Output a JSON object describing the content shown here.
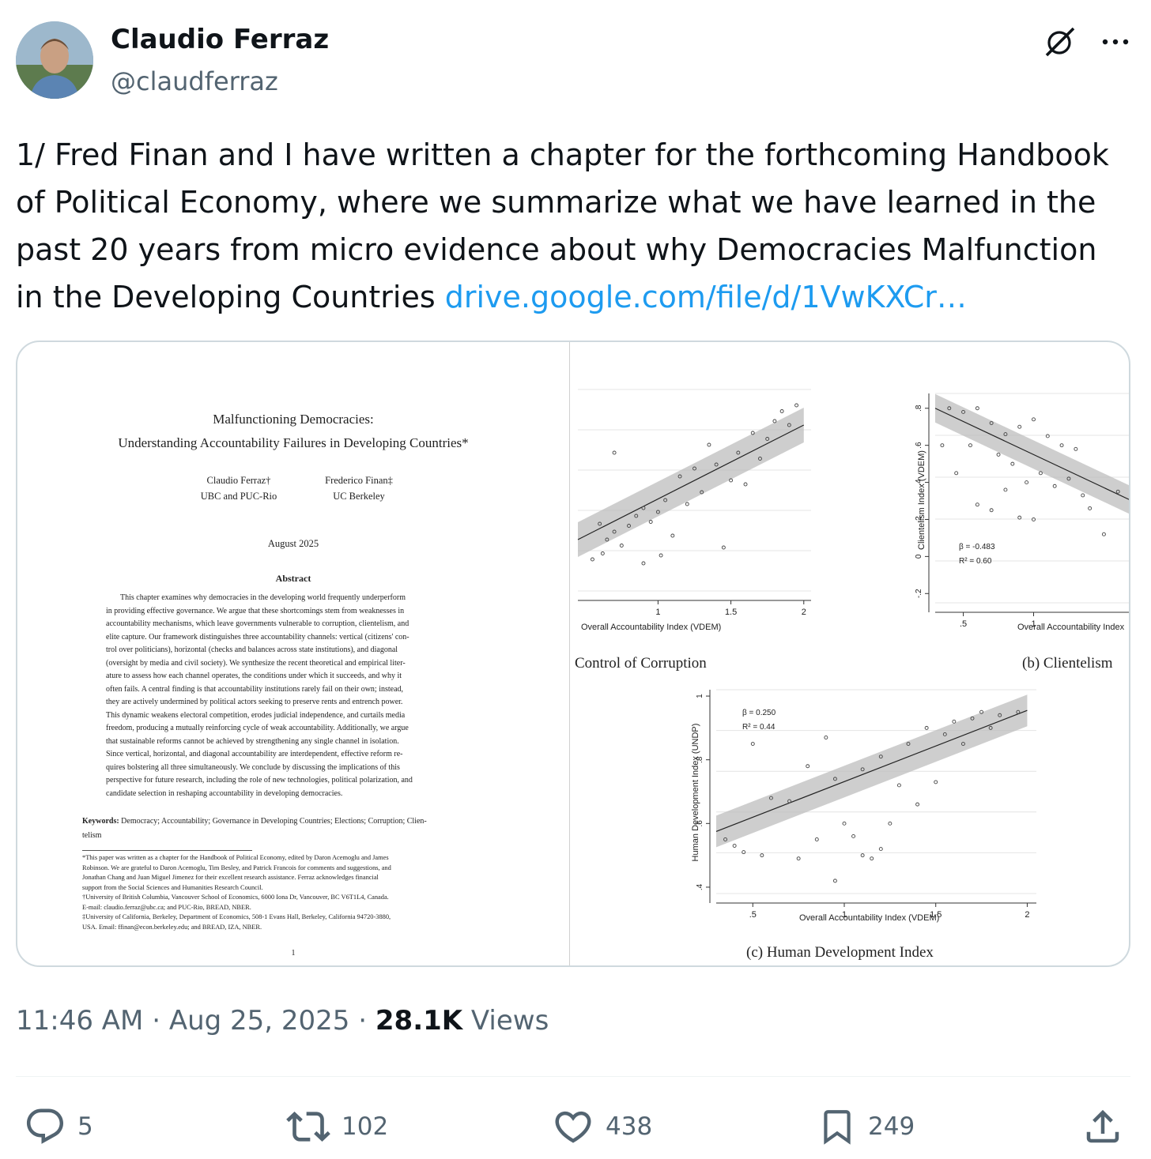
{
  "author": {
    "name": "Claudio Ferraz",
    "handle": "@claudferraz"
  },
  "tweet": {
    "text": "1/ Fred Finan and I have written a chapter for the forthcoming Handbook of Political Economy, where we summarize what we have learned in the past 20 years from micro evidence about why Democracies Malfunction in the Developing Countries",
    "link": "drive.google.com/file/d/1VwKXCr…"
  },
  "paper": {
    "title_line1": "Malfunctioning Democracies:",
    "title_line2": "Understanding Accountability Failures in Developing Countries*",
    "author1_name": "Claudio Ferraz†",
    "author1_affil": "UBC and PUC-Rio",
    "author2_name": "Frederico Finan‡",
    "author2_affil": "UC Berkeley",
    "date": "August 2025",
    "abstract_heading": "Abstract",
    "abstract_lines": [
      "This chapter examines why democracies in the developing world frequently underperform",
      "in providing effective governance. We argue that these shortcomings stem from weaknesses in",
      "accountability mechanisms, which leave governments vulnerable to corruption, clientelism, and",
      "elite capture. Our framework distinguishes three accountability channels: vertical (citizens' con-",
      "trol over politicians), horizontal (checks and balances across state institutions), and diagonal",
      "(oversight by media and civil society). We synthesize the recent theoretical and empirical liter-",
      "ature to assess how each channel operates, the conditions under which it succeeds, and why it",
      "often fails. A central finding is that accountability institutions rarely fail on their own; instead,",
      "they are actively undermined by political actors seeking to preserve rents and entrench power.",
      "This dynamic weakens electoral competition, erodes judicial independence, and curtails media",
      "freedom, producing a mutually reinforcing cycle of weak accountability. Additionally, we argue",
      "that sustainable reforms cannot be achieved by strengthening any single channel in isolation.",
      "Since vertical, horizontal, and diagonal accountability are interdependent, effective reform re-",
      "quires bolstering all three simultaneously. We conclude by discussing the implications of this",
      "perspective for future research, including the role of new technologies, political polarization, and",
      "candidate selection in reshaping accountability in developing democracies."
    ],
    "keywords_label": "Keywords:",
    "keywords_line1": "Democracy; Accountability; Governance in Developing Countries; Elections; Corruption; Clien-",
    "keywords_line2": "telism",
    "footnote_lines": [
      "*This paper was written as a chapter for the Handbook of Political Economy, edited by Daron Acemoglu and James",
      "Robinson. We are grateful to Daron Acemoglu, Tim Besley, and Patrick Francois for comments and suggestions, and",
      "Jonathan Chang and Juan Miguel Jimenez for their excellent research assistance.  Ferraz acknowledges financial",
      "support from the Social Sciences and Humanities Research Council.",
      "†University of British Columbia, Vancouver School of Economics, 6000 Iona Dr, Vancouver, BC V6T1L4, Canada.",
      "E-mail: claudio.ferraz@ubc.ca; and PUC-Rio, BREAD, NBER.",
      "‡University of California, Berkeley, Department of Economics, 508-1 Evans Hall, Berkeley, California 94720-3880,",
      "USA. Email: ffinan@econ.berkeley.edu; and BREAD, IZA, NBER."
    ],
    "page_number": "1"
  },
  "chart_data": [
    {
      "type": "scatter",
      "title": "Control of Corruption",
      "xlabel": "Overall Accountability Index (VDEM)",
      "ylabel": "",
      "xticks": [
        "1",
        "1.5",
        "2"
      ],
      "xlim": [
        0.45,
        2.05
      ],
      "ylim": [
        -2.6,
        2.5
      ],
      "fit": {
        "x": [
          0.45,
          2.0
        ],
        "y": [
          -1.3,
          1.6
        ]
      },
      "points": [
        {
          "x": 0.6,
          "y": -0.9
        },
        {
          "x": 0.65,
          "y": -1.3
        },
        {
          "x": 0.7,
          "y": -1.1
        },
        {
          "x": 0.75,
          "y": -1.45
        },
        {
          "x": 0.8,
          "y": -0.95
        },
        {
          "x": 0.85,
          "y": -0.7
        },
        {
          "x": 0.9,
          "y": -0.5
        },
        {
          "x": 0.95,
          "y": -0.85
        },
        {
          "x": 1.0,
          "y": -0.6
        },
        {
          "x": 1.05,
          "y": -0.3
        },
        {
          "x": 1.1,
          "y": -1.2
        },
        {
          "x": 1.15,
          "y": 0.3
        },
        {
          "x": 1.2,
          "y": -0.4
        },
        {
          "x": 1.25,
          "y": 0.5
        },
        {
          "x": 1.3,
          "y": -0.1
        },
        {
          "x": 1.35,
          "y": 1.1
        },
        {
          "x": 1.4,
          "y": 0.6
        },
        {
          "x": 1.45,
          "y": -1.5
        },
        {
          "x": 1.5,
          "y": 0.2
        },
        {
          "x": 1.55,
          "y": 0.9
        },
        {
          "x": 1.6,
          "y": 0.1
        },
        {
          "x": 1.65,
          "y": 1.4
        },
        {
          "x": 1.7,
          "y": 0.75
        },
        {
          "x": 1.75,
          "y": 1.25
        },
        {
          "x": 1.8,
          "y": 1.7
        },
        {
          "x": 1.85,
          "y": 1.95
        },
        {
          "x": 1.9,
          "y": 1.6
        },
        {
          "x": 1.95,
          "y": 2.1
        },
        {
          "x": 0.55,
          "y": -1.8
        },
        {
          "x": 0.7,
          "y": 0.9
        },
        {
          "x": 0.62,
          "y": -1.65
        },
        {
          "x": 0.9,
          "y": -1.9
        },
        {
          "x": 1.02,
          "y": -1.7
        }
      ]
    },
    {
      "type": "scatter",
      "title": "(b) Clientelism",
      "xlabel": "Overall Accountability Index",
      "ylabel": "Clientelism Index (VDEM)",
      "yticks": [
        "-.2",
        "0",
        ".2",
        ".4",
        ".6",
        ".8"
      ],
      "xticks": [
        ".5",
        "1"
      ],
      "xlim": [
        0.3,
        1.7
      ],
      "ylim": [
        -0.25,
        0.88
      ],
      "annotations": [
        "β = -0.483",
        "R² = 0.60"
      ],
      "fit": {
        "x": [
          0.3,
          1.7
        ],
        "y": [
          0.8,
          0.3
        ]
      },
      "points": [
        {
          "x": 0.4,
          "y": 0.8
        },
        {
          "x": 0.5,
          "y": 0.78
        },
        {
          "x": 0.6,
          "y": 0.8
        },
        {
          "x": 0.7,
          "y": 0.72
        },
        {
          "x": 0.8,
          "y": 0.66
        },
        {
          "x": 0.9,
          "y": 0.7
        },
        {
          "x": 1.0,
          "y": 0.74
        },
        {
          "x": 1.1,
          "y": 0.65
        },
        {
          "x": 1.2,
          "y": 0.6
        },
        {
          "x": 1.3,
          "y": 0.58
        },
        {
          "x": 0.35,
          "y": 0.6
        },
        {
          "x": 0.45,
          "y": 0.45
        },
        {
          "x": 0.55,
          "y": 0.6
        },
        {
          "x": 0.75,
          "y": 0.55
        },
        {
          "x": 0.85,
          "y": 0.5
        },
        {
          "x": 0.95,
          "y": 0.4
        },
        {
          "x": 1.05,
          "y": 0.45
        },
        {
          "x": 1.15,
          "y": 0.38
        },
        {
          "x": 1.25,
          "y": 0.42
        },
        {
          "x": 1.35,
          "y": 0.33
        },
        {
          "x": 0.6,
          "y": 0.28
        },
        {
          "x": 0.8,
          "y": 0.36
        },
        {
          "x": 0.9,
          "y": 0.21
        },
        {
          "x": 1.0,
          "y": 0.2
        },
        {
          "x": 1.4,
          "y": 0.26
        },
        {
          "x": 1.5,
          "y": 0.12
        },
        {
          "x": 1.6,
          "y": 0.35
        },
        {
          "x": 0.7,
          "y": 0.25
        }
      ]
    },
    {
      "type": "scatter",
      "title": "(c) Human Development Index",
      "xlabel": "Overall Accountability Index (VDEM)",
      "ylabel": "Human Development Index (UNDP)",
      "yticks": [
        ".4",
        ".6",
        ".8",
        "1"
      ],
      "xticks": [
        ".5",
        "1",
        "1.5",
        "2"
      ],
      "xlim": [
        0.3,
        2.05
      ],
      "ylim": [
        0.38,
        1.02
      ],
      "annotations": [
        "β = 0.250",
        "R² = 0.44"
      ],
      "fit": {
        "x": [
          0.3,
          2.0
        ],
        "y": [
          0.575,
          0.955
        ]
      },
      "points": [
        {
          "x": 0.35,
          "y": 0.55
        },
        {
          "x": 0.4,
          "y": 0.53
        },
        {
          "x": 0.45,
          "y": 0.51
        },
        {
          "x": 0.5,
          "y": 0.85
        },
        {
          "x": 0.55,
          "y": 0.5
        },
        {
          "x": 0.6,
          "y": 0.68
        },
        {
          "x": 0.7,
          "y": 0.67
        },
        {
          "x": 0.8,
          "y": 0.78
        },
        {
          "x": 0.85,
          "y": 0.55
        },
        {
          "x": 0.9,
          "y": 0.87
        },
        {
          "x": 0.95,
          "y": 0.74
        },
        {
          "x": 1.0,
          "y": 0.6
        },
        {
          "x": 1.05,
          "y": 0.56
        },
        {
          "x": 1.1,
          "y": 0.77
        },
        {
          "x": 1.15,
          "y": 0.49
        },
        {
          "x": 1.2,
          "y": 0.81
        },
        {
          "x": 1.25,
          "y": 0.6
        },
        {
          "x": 1.3,
          "y": 0.72
        },
        {
          "x": 1.35,
          "y": 0.85
        },
        {
          "x": 1.4,
          "y": 0.66
        },
        {
          "x": 1.45,
          "y": 0.9
        },
        {
          "x": 1.5,
          "y": 0.73
        },
        {
          "x": 1.55,
          "y": 0.88
        },
        {
          "x": 1.6,
          "y": 0.92
        },
        {
          "x": 1.65,
          "y": 0.85
        },
        {
          "x": 1.7,
          "y": 0.93
        },
        {
          "x": 1.75,
          "y": 0.95
        },
        {
          "x": 1.8,
          "y": 0.9
        },
        {
          "x": 1.85,
          "y": 0.94
        },
        {
          "x": 1.95,
          "y": 0.95
        },
        {
          "x": 0.75,
          "y": 0.49
        },
        {
          "x": 0.95,
          "y": 0.42
        },
        {
          "x": 1.1,
          "y": 0.5
        },
        {
          "x": 1.2,
          "y": 0.52
        }
      ]
    }
  ],
  "meta": {
    "time": "11:46 AM",
    "date": "Aug 25, 2025",
    "views_count": "28.1K",
    "views_label": "Views",
    "sep": "·"
  },
  "actions": {
    "replies": "5",
    "retweets": "102",
    "likes": "438",
    "bookmarks": "249"
  },
  "colors": {
    "link": "#1d9bf0",
    "muted": "#536471",
    "text": "#0f1419"
  },
  "icons": [
    "grok-icon",
    "more-icon",
    "reply-icon",
    "retweet-icon",
    "like-icon",
    "bookmark-icon",
    "share-icon"
  ]
}
